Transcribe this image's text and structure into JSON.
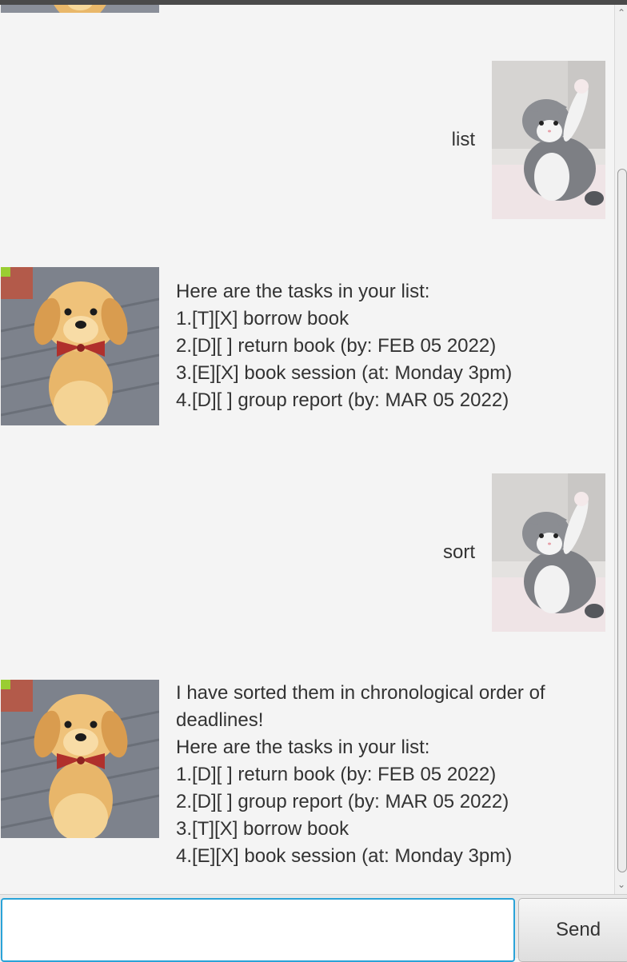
{
  "chat": {
    "messages": [
      {
        "sender": "user",
        "avatar": "kitten-avatar",
        "text": "list"
      },
      {
        "sender": "bot",
        "avatar": "puppy-avatar",
        "lines": [
          "Here are the tasks in your list:",
          "1.[T][X] borrow book",
          "2.[D][ ] return book (by: FEB 05 2022)",
          "3.[E][X] book session (at: Monday 3pm)",
          "4.[D][ ] group report (by: MAR 05 2022)"
        ]
      },
      {
        "sender": "user",
        "avatar": "kitten-avatar",
        "text": "sort"
      },
      {
        "sender": "bot",
        "avatar": "puppy-avatar",
        "lines": [
          "I have sorted them in chronological order of",
          "deadlines!",
          "Here are the tasks in your list:",
          "1.[D][ ] return book (by: FEB 05 2022)",
          "2.[D][ ] group report (by: MAR 05 2022)",
          "3.[T][X] borrow book",
          "4.[E][X] book session (at: Monday 3pm)"
        ]
      }
    ]
  },
  "input": {
    "value": "",
    "placeholder": ""
  },
  "send_button": {
    "label": "Send"
  },
  "scrollbar": {
    "up_icon": "chevron-up-icon",
    "down_icon": "chevron-down-icon",
    "position": 0.96
  },
  "colors": {
    "background": "#f4f4f4",
    "input_focus_border": "#2aa3d8",
    "text": "#333333"
  }
}
